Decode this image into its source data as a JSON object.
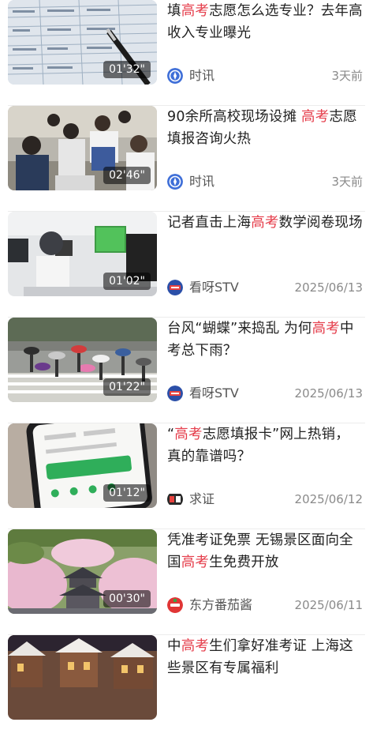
{
  "items": [
    {
      "title_parts": [
        "填",
        "高考",
        "志愿怎么选专业？去年高收入专业曝光"
      ],
      "duration": "01'32\"",
      "source": "时讯",
      "time": "3天前",
      "source_icon": "compass-icon",
      "thumb": "spreadsheet-pen-photo"
    },
    {
      "title_parts": [
        "90余所高校现场设摊 ",
        "高考",
        "志愿填报咨询火热"
      ],
      "duration": "02'46\"",
      "source": "时讯",
      "time": "3天前",
      "source_icon": "compass-icon",
      "thumb": "consultation-crowd-photo"
    },
    {
      "title_parts": [
        "记者直击上海",
        "高考",
        "数学阅卷现场"
      ],
      "duration": "01'02\"",
      "source": "看呀STV",
      "time": "2025/06/13",
      "source_icon": "stv-logo-icon",
      "thumb": "grading-room-photo"
    },
    {
      "title_parts": [
        "台风“蝴蝶”来捣乱 为何",
        "高考",
        "中考总下雨？"
      ],
      "duration": "01'22\"",
      "source": "看呀STV",
      "time": "2025/06/13",
      "source_icon": "stv-logo-icon",
      "thumb": "rain-umbrellas-photo"
    },
    {
      "title_parts": [
        "“",
        "高考",
        "志愿填报卡”网上热销，真的靠谱吗？"
      ],
      "duration": "01'12\"",
      "source": "求证",
      "time": "2025/06/12",
      "source_icon": "verify-logo-icon",
      "thumb": "phone-app-photo"
    },
    {
      "title_parts": [
        "凭准考证免票 无锡景区面向全国",
        "高考",
        "生免费开放"
      ],
      "duration": "00'30\"",
      "source": "东方番茄酱",
      "time": "2025/06/11",
      "source_icon": "tomato-logo-icon",
      "thumb": "cherry-blossom-photo"
    },
    {
      "title_parts": [
        "中",
        "高考",
        "生们拿好准考证 上海这些景区有专属福利"
      ],
      "duration": "",
      "source": "",
      "time": "",
      "source_icon": "",
      "thumb": "scenic-town-photo"
    }
  ],
  "colors": {
    "highlight": "#e53c4a",
    "text": "#222222",
    "meta": "#8a8a8a"
  }
}
